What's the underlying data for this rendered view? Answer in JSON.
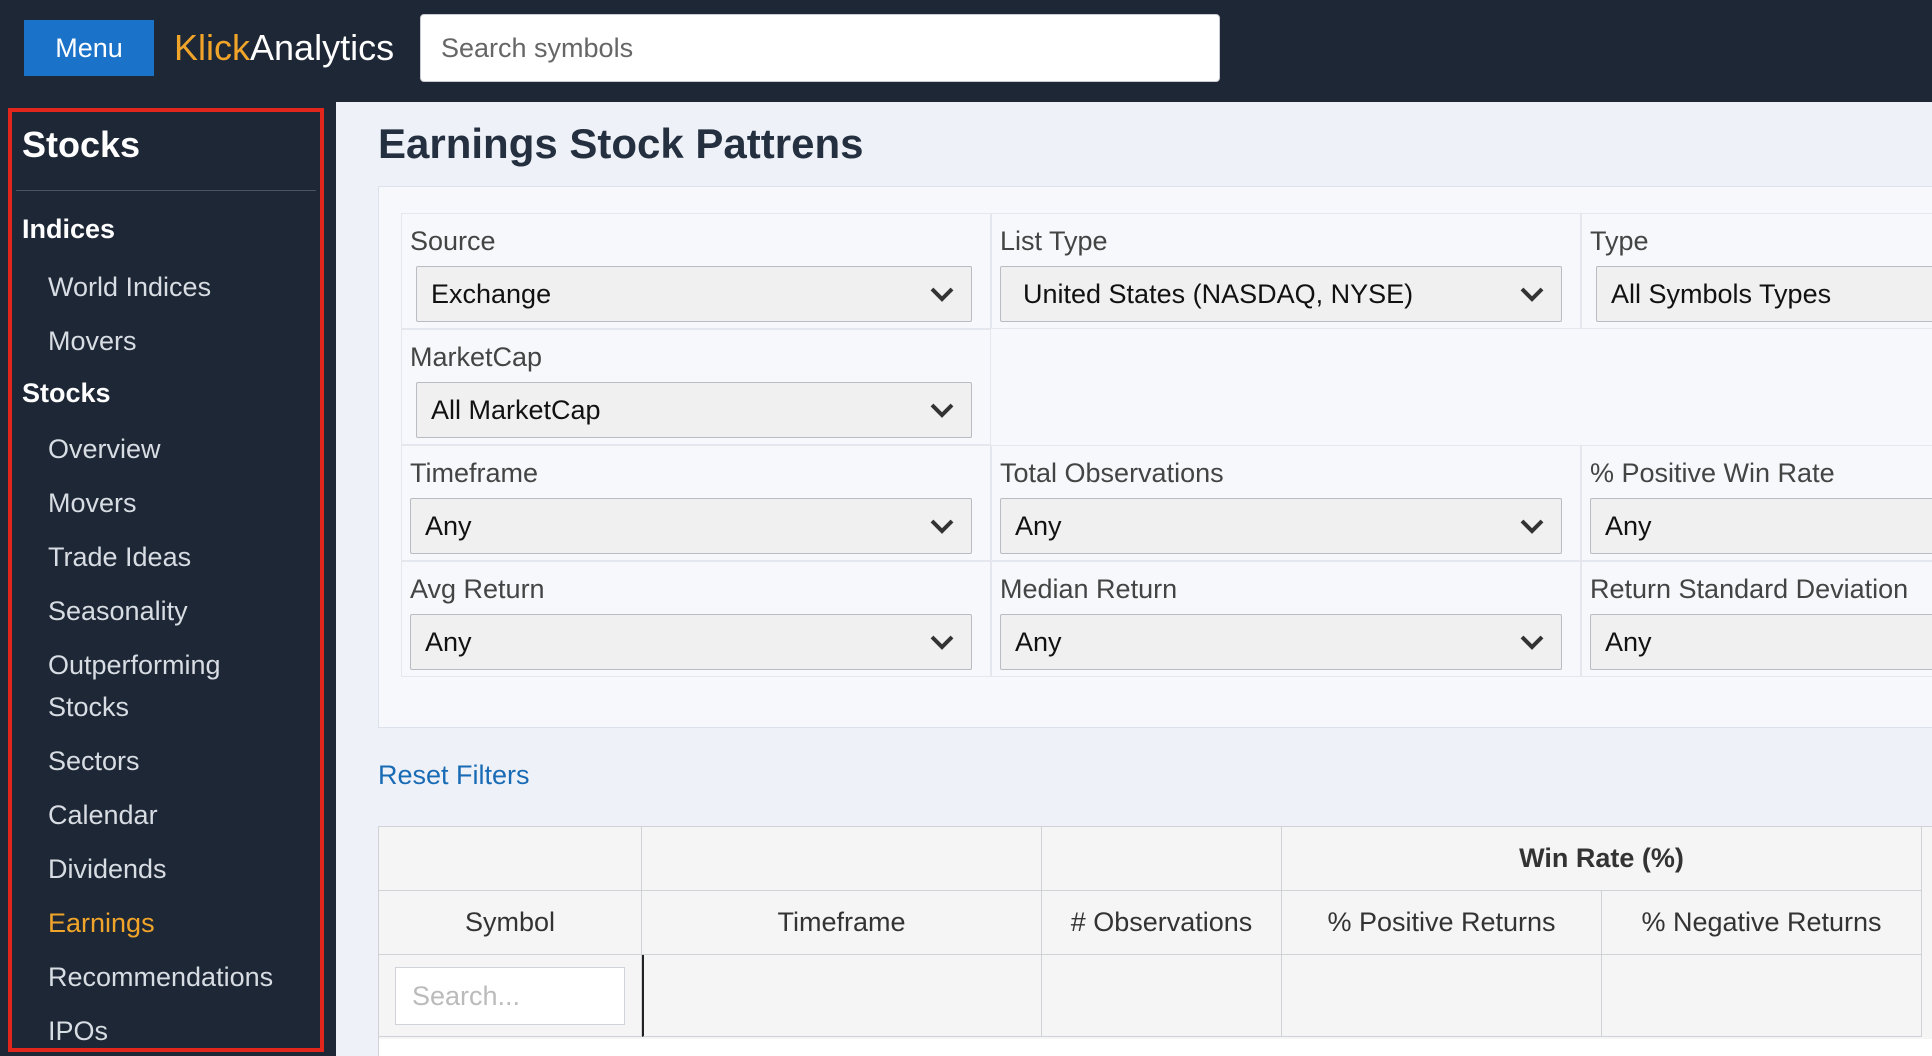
{
  "header": {
    "menu_label": "Menu",
    "brand_part1": "Klick",
    "brand_part2": "Analytics",
    "search_placeholder": "Search symbols"
  },
  "sidebar": {
    "title": "Stocks",
    "sections": [
      {
        "label": "Indices",
        "items": [
          "World Indices",
          "Movers"
        ]
      },
      {
        "label": "Stocks",
        "items": [
          "Overview",
          "Movers",
          "Trade Ideas",
          "Seasonality",
          "Outperforming Stocks",
          "Sectors",
          "Calendar",
          "Dividends",
          "Earnings",
          "Recommendations",
          "IPOs"
        ]
      }
    ],
    "active_item": "Earnings"
  },
  "main": {
    "title": "Earnings Stock Pattrens",
    "filters": {
      "source": {
        "label": "Source",
        "value": "Exchange"
      },
      "list_type": {
        "label": "List Type",
        "value": "United States (NASDAQ, NYSE)"
      },
      "type": {
        "label": "Type",
        "value": "All Symbols Types"
      },
      "marketcap": {
        "label": "MarketCap",
        "value": "All MarketCap"
      },
      "timeframe": {
        "label": "Timeframe",
        "value": "Any"
      },
      "total_observations": {
        "label": "Total Observations",
        "value": "Any"
      },
      "positive_win_rate": {
        "label": "% Positive Win Rate",
        "value": "Any"
      },
      "avg_return": {
        "label": "Avg Return",
        "value": "Any"
      },
      "median_return": {
        "label": "Median Return",
        "value": "Any"
      },
      "return_std": {
        "label": "Return Standard Deviation",
        "value": "Any"
      }
    },
    "reset_label": "Reset Filters",
    "table": {
      "group_header": "Win Rate (%)",
      "columns": [
        "Symbol",
        "Timeframe",
        "# Observations",
        "% Positive Returns",
        "% Negative Returns"
      ],
      "symbol_search_placeholder": "Search..."
    }
  },
  "colors": {
    "accent": "#f0a52a",
    "menu_button": "#1a73c8",
    "highlight_border": "#e3261c",
    "link": "#1a6bb5"
  }
}
